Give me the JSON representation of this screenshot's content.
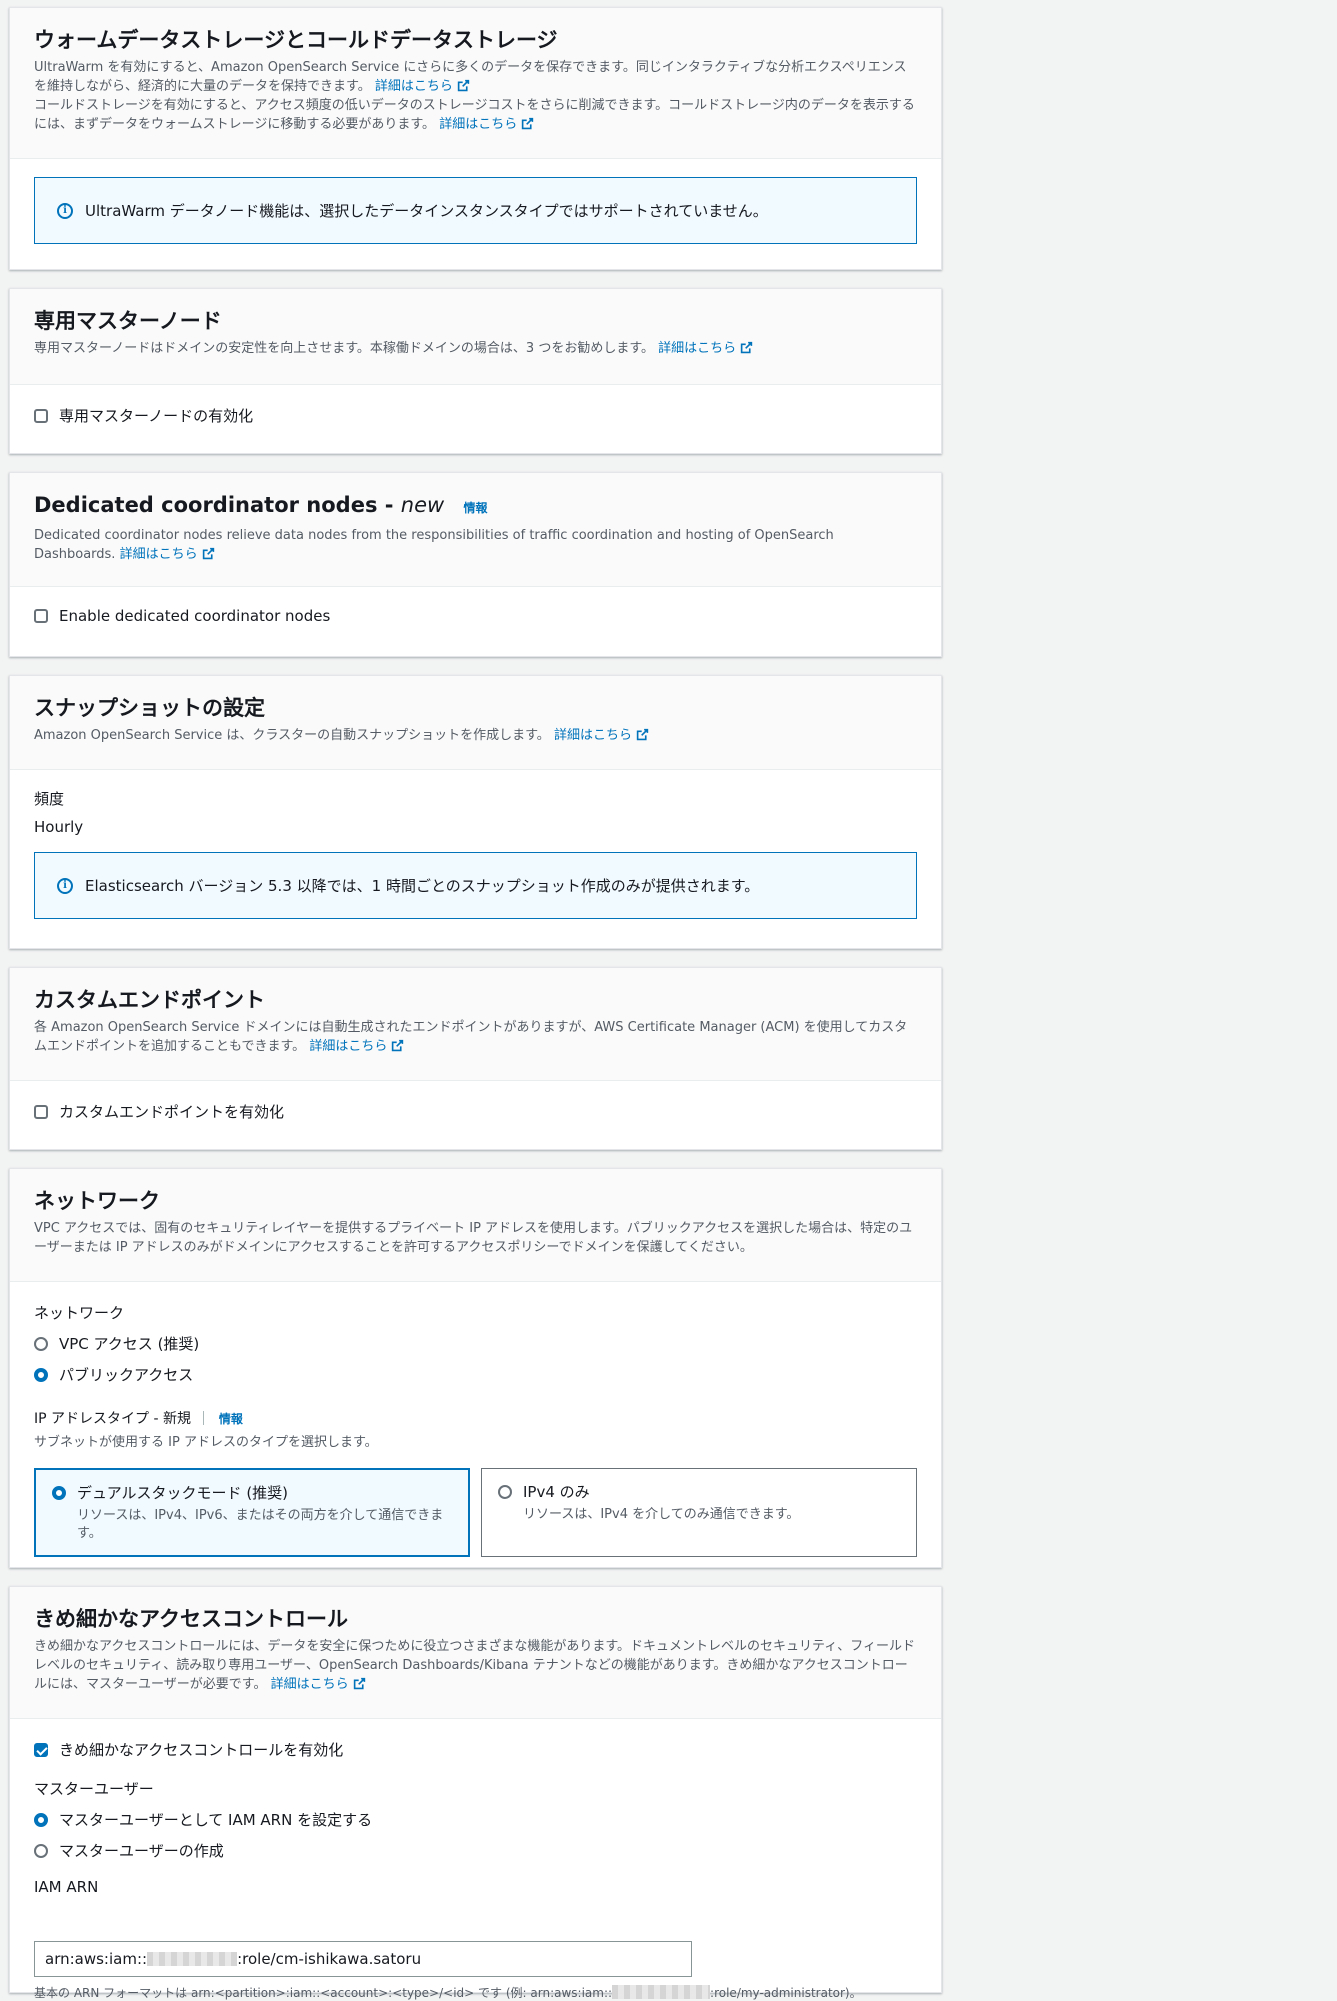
{
  "warm_cold": {
    "title": "ウォームデータストレージとコールドデータストレージ",
    "desc1": "UltraWarm を有効にすると、Amazon OpenSearch Service にさらに多くのデータを保存できます。同じインタラクティブな分析エクスペリエンスを維持しながら、経済的に大量のデータを保持できます。",
    "desc2": "コールドストレージを有効にすると、アクセス頻度の低いデータのストレージコストをさらに削減できます。コールドストレージ内のデータを表示するには、まずデータをウォームストレージに移動する必要があります。",
    "learn_more": "詳細はこちら",
    "alert": "UltraWarm データノード機能は、選択したデータインスタンスタイプではサポートされていません。"
  },
  "dedicated_master": {
    "title": "専用マスターノード",
    "desc": "専用マスターノードはドメインの安定性を向上させます。本稼働ドメインの場合は、3 つをお勧めします。",
    "learn_more": "詳細はこちら",
    "checkbox_label": "専用マスターノードの有効化",
    "checked": false
  },
  "coordinator": {
    "title": "Dedicated coordinator nodes - ",
    "title_new": "new",
    "info": "情報",
    "desc": "Dedicated coordinator nodes relieve data nodes from the responsibilities of traffic coordination and hosting of OpenSearch Dashboards.",
    "learn_more": "詳細はこちら",
    "checkbox_label": "Enable dedicated coordinator nodes",
    "checked": false
  },
  "snapshot": {
    "title": "スナップショットの設定",
    "desc": "Amazon OpenSearch Service は、クラスターの自動スナップショットを作成します。",
    "learn_more": "詳細はこちら",
    "freq_label": "頻度",
    "freq_value": "Hourly",
    "alert": "Elasticsearch バージョン 5.3 以降では、1 時間ごとのスナップショット作成のみが提供されます。"
  },
  "endpoint": {
    "title": "カスタムエンドポイント",
    "desc": "各 Amazon OpenSearch Service ドメインには自動生成されたエンドポイントがありますが、AWS Certificate Manager (ACM) を使用してカスタムエンドポイントを追加することもできます。",
    "learn_more": "詳細はこちら",
    "checkbox_label": "カスタムエンドポイントを有効化",
    "checked": false
  },
  "network": {
    "title": "ネットワーク",
    "desc": "VPC アクセスでは、固有のセキュリティレイヤーを提供するプライベート IP アドレスを使用します。パブリックアクセスを選択した場合は、特定のユーザーまたは IP アドレスのみがドメインにアクセスすることを許可するアクセスポリシーでドメインを保護してください。",
    "field_label": "ネットワーク",
    "options": [
      "VPC アクセス (推奨)",
      "パブリックアクセス"
    ],
    "selected": "パブリックアクセス",
    "ip_label": "IP アドレスタイプ - 新規",
    "ip_info": "情報",
    "ip_desc": "サブネットが使用する IP アドレスのタイプを選択します。",
    "tiles": [
      {
        "title": "デュアルスタックモード (推奨)",
        "desc": "リソースは、IPv4、IPv6、またはその両方を介して通信できます。",
        "selected": true
      },
      {
        "title": "IPv4 のみ",
        "desc": "リソースは、IPv4 を介してのみ通信できます。",
        "selected": false
      }
    ]
  },
  "fgac": {
    "title": "きめ細かなアクセスコントロール",
    "desc": "きめ細かなアクセスコントロールには、データを安全に保つために役立つさまざまな機能があります。ドキュメントレベルのセキュリティ、フィールドレベルのセキュリティ、読み取り専用ユーザー、OpenSearch Dashboards/Kibana テナントなどの機能があります。きめ細かなアクセスコントロールには、マスターユーザーが必要です。",
    "learn_more": "詳細はこちら",
    "checkbox_label": "きめ細かなアクセスコントロールを有効化",
    "checked": true,
    "master_label": "マスターユーザー",
    "master_options": [
      "マスターユーザーとして IAM ARN を設定する",
      "マスターユーザーの作成"
    ],
    "master_selected": "マスターユーザーとして IAM ARN を設定する",
    "arn_label": "IAM ARN",
    "arn_prefix": "arn:aws:iam::",
    "arn_suffix": ":role/cm-ishikawa.satoru",
    "arn_hint_prefix": "基本の ARN フォーマットは arn:<partition>:iam::<account>:<type>/<id> です (例: arn:aws:iam::",
    "arn_hint_suffix": ":role/my-administrator)。"
  },
  "colors": {
    "accent": "#0073bb",
    "text": "#16191f",
    "muted": "#545b64",
    "page_bg": "#f2f3f3"
  }
}
